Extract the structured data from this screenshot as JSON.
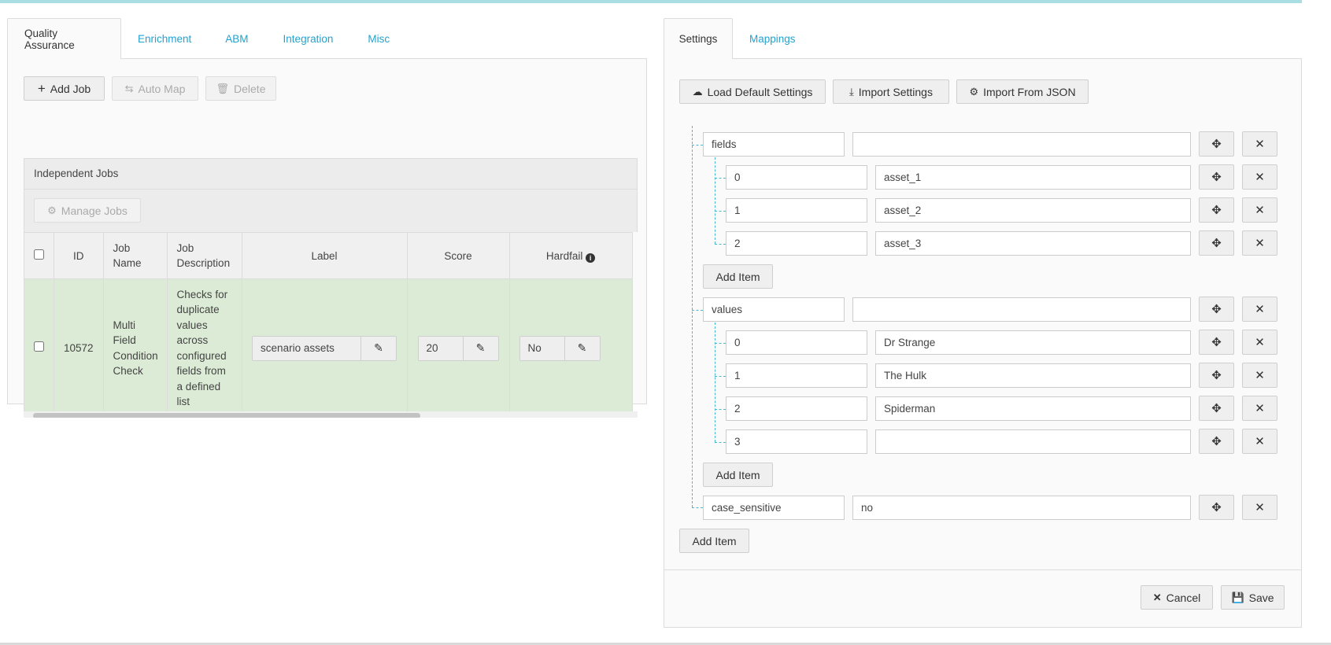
{
  "left": {
    "tabs": [
      {
        "label": "Quality Assurance",
        "active": true
      },
      {
        "label": "Enrichment",
        "active": false
      },
      {
        "label": "ABM",
        "active": false
      },
      {
        "label": "Integration",
        "active": false
      },
      {
        "label": "Misc",
        "active": false
      }
    ],
    "toolbar": {
      "add_job": "Add Job",
      "auto_map": "Auto Map",
      "delete": "Delete"
    },
    "group_title": "Independent Jobs",
    "manage_jobs": "Manage Jobs",
    "columns": {
      "id": "ID",
      "job_name": "Job Name",
      "job_description": "Job Description",
      "label": "Label",
      "score": "Score",
      "hardfail": "Hardfail"
    },
    "row": {
      "id": "10572",
      "job_name": "Multi Field Condition Check",
      "job_description": "Checks for duplicate values across configured fields from a defined list",
      "label": "scenario assets",
      "score": "20",
      "hardfail": "No"
    }
  },
  "right": {
    "tabs": [
      {
        "label": "Settings",
        "active": true
      },
      {
        "label": "Mappings",
        "active": false
      }
    ],
    "toolbar": {
      "load_default": "Load Default Settings",
      "import_settings": "Import Settings",
      "import_json": "Import From JSON"
    },
    "tree": {
      "fields_key": "fields",
      "fields_value": "",
      "fields_items": [
        {
          "key": "0",
          "value": "asset_1"
        },
        {
          "key": "1",
          "value": "asset_2"
        },
        {
          "key": "2",
          "value": "asset_3"
        }
      ],
      "values_key": "values",
      "values_value": "",
      "values_items": [
        {
          "key": "0",
          "value": "Dr Strange"
        },
        {
          "key": "1",
          "value": "The Hulk"
        },
        {
          "key": "2",
          "value": "Spiderman"
        },
        {
          "key": "3",
          "value": ""
        }
      ],
      "case_key": "case_sensitive",
      "case_value": "no",
      "add_item": "Add Item"
    },
    "footer": {
      "cancel": "Cancel",
      "save": "Save"
    }
  },
  "colors": {
    "accent": "#22a3cf",
    "row_highlight": "#dcebd6",
    "tree_line": "#4ab8cf"
  }
}
